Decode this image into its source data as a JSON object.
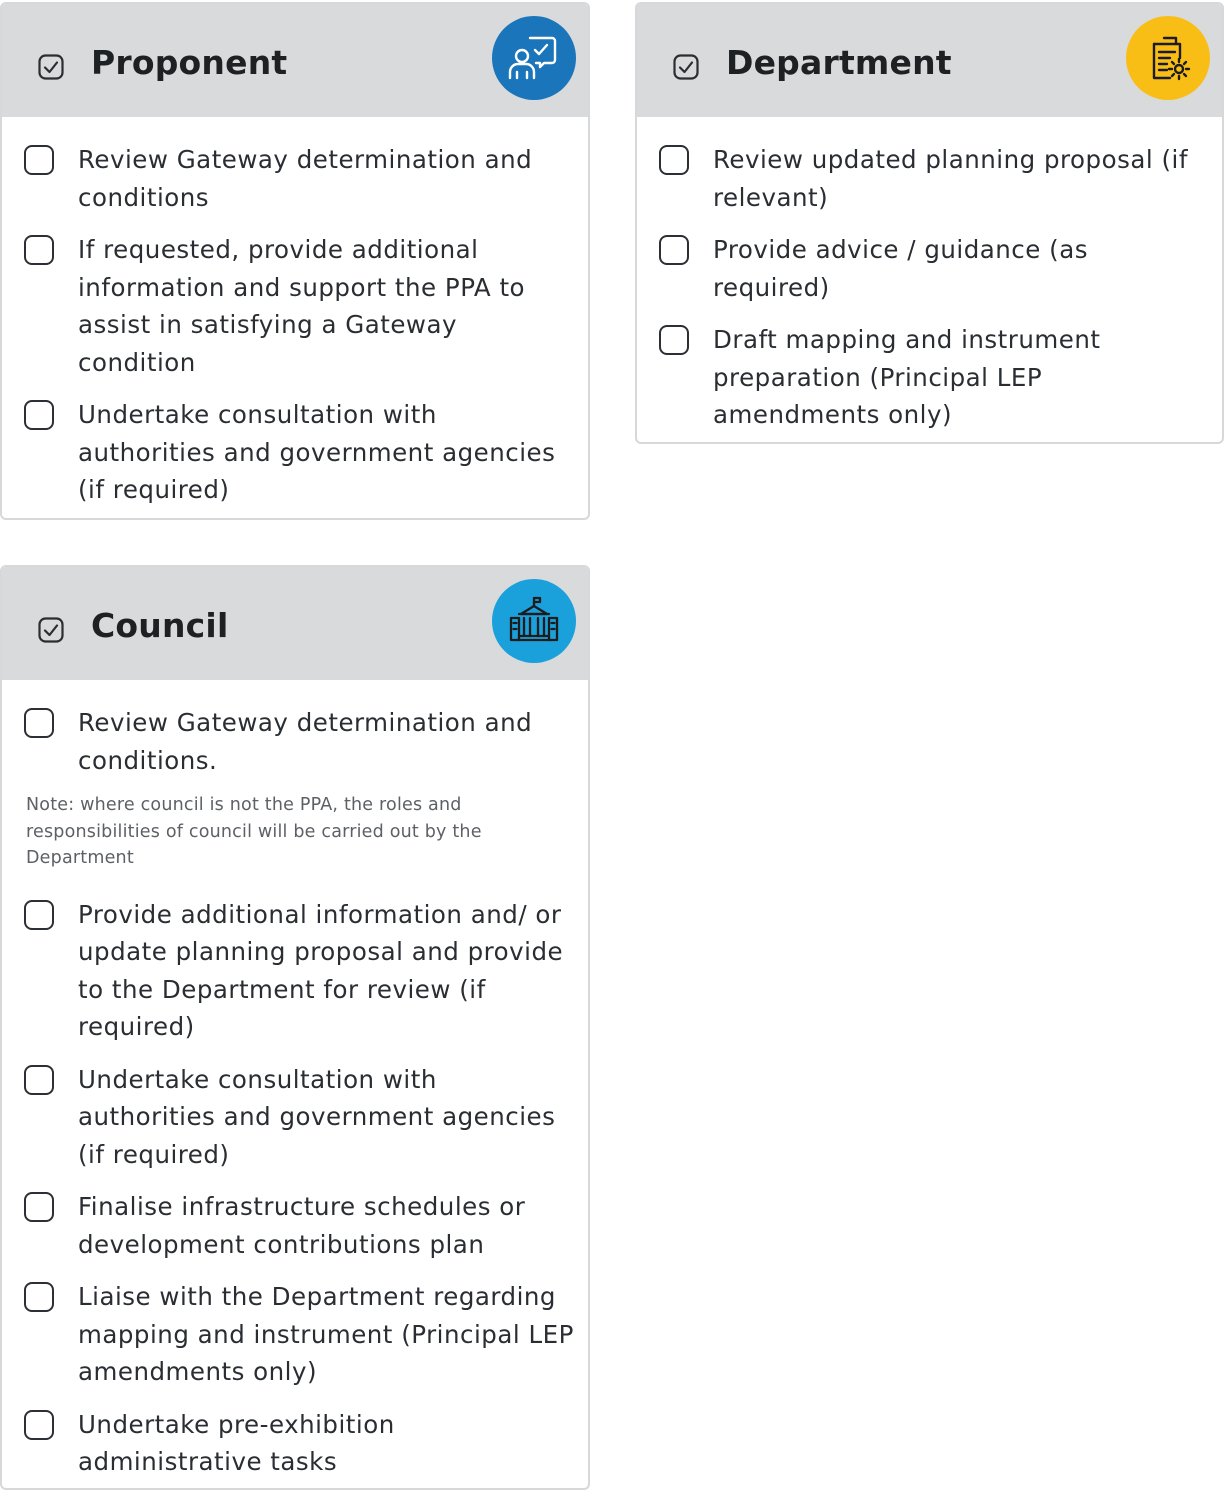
{
  "cards": {
    "proponent": {
      "title": "Proponent",
      "badge_color": "#1b75bb",
      "badge_icon": "presentation-icon",
      "items": [
        {
          "text": "Review Gateway determination and conditions"
        },
        {
          "text": "If requested, provide additional information and support the PPA to assist in satisfying a Gateway condition"
        },
        {
          "text": "Undertake consultation with authorities and government agencies (if required)"
        }
      ]
    },
    "department": {
      "title": "Department",
      "badge_color": "#f9be16",
      "badge_icon": "document-settings-icon",
      "items": [
        {
          "text": "Review updated planning proposal (if relevant)"
        },
        {
          "text": "Provide advice / guidance (as required)"
        },
        {
          "text": "Draft mapping and instrument preparation (Principal LEP amendments only)"
        }
      ]
    },
    "council": {
      "title": "Council",
      "badge_color": "#1aa0db",
      "badge_icon": "government-building-icon",
      "items": [
        {
          "text": "Review Gateway determination and conditions."
        },
        {
          "text": "Provide additional information and/ or update planning proposal and provide to the Department for review (if required)"
        },
        {
          "text": "Undertake consultation with authorities and government agencies (if required)"
        },
        {
          "text": "Finalise infrastructure schedules or development contributions plan"
        },
        {
          "text": "Liaise with the Department regarding mapping and instrument (Principal LEP amendments only)"
        },
        {
          "text": "Undertake pre-exhibition administrative tasks"
        }
      ],
      "note": "Note: where council is not the PPA, the roles and responsibilities of council will be carried out by the Department"
    }
  }
}
